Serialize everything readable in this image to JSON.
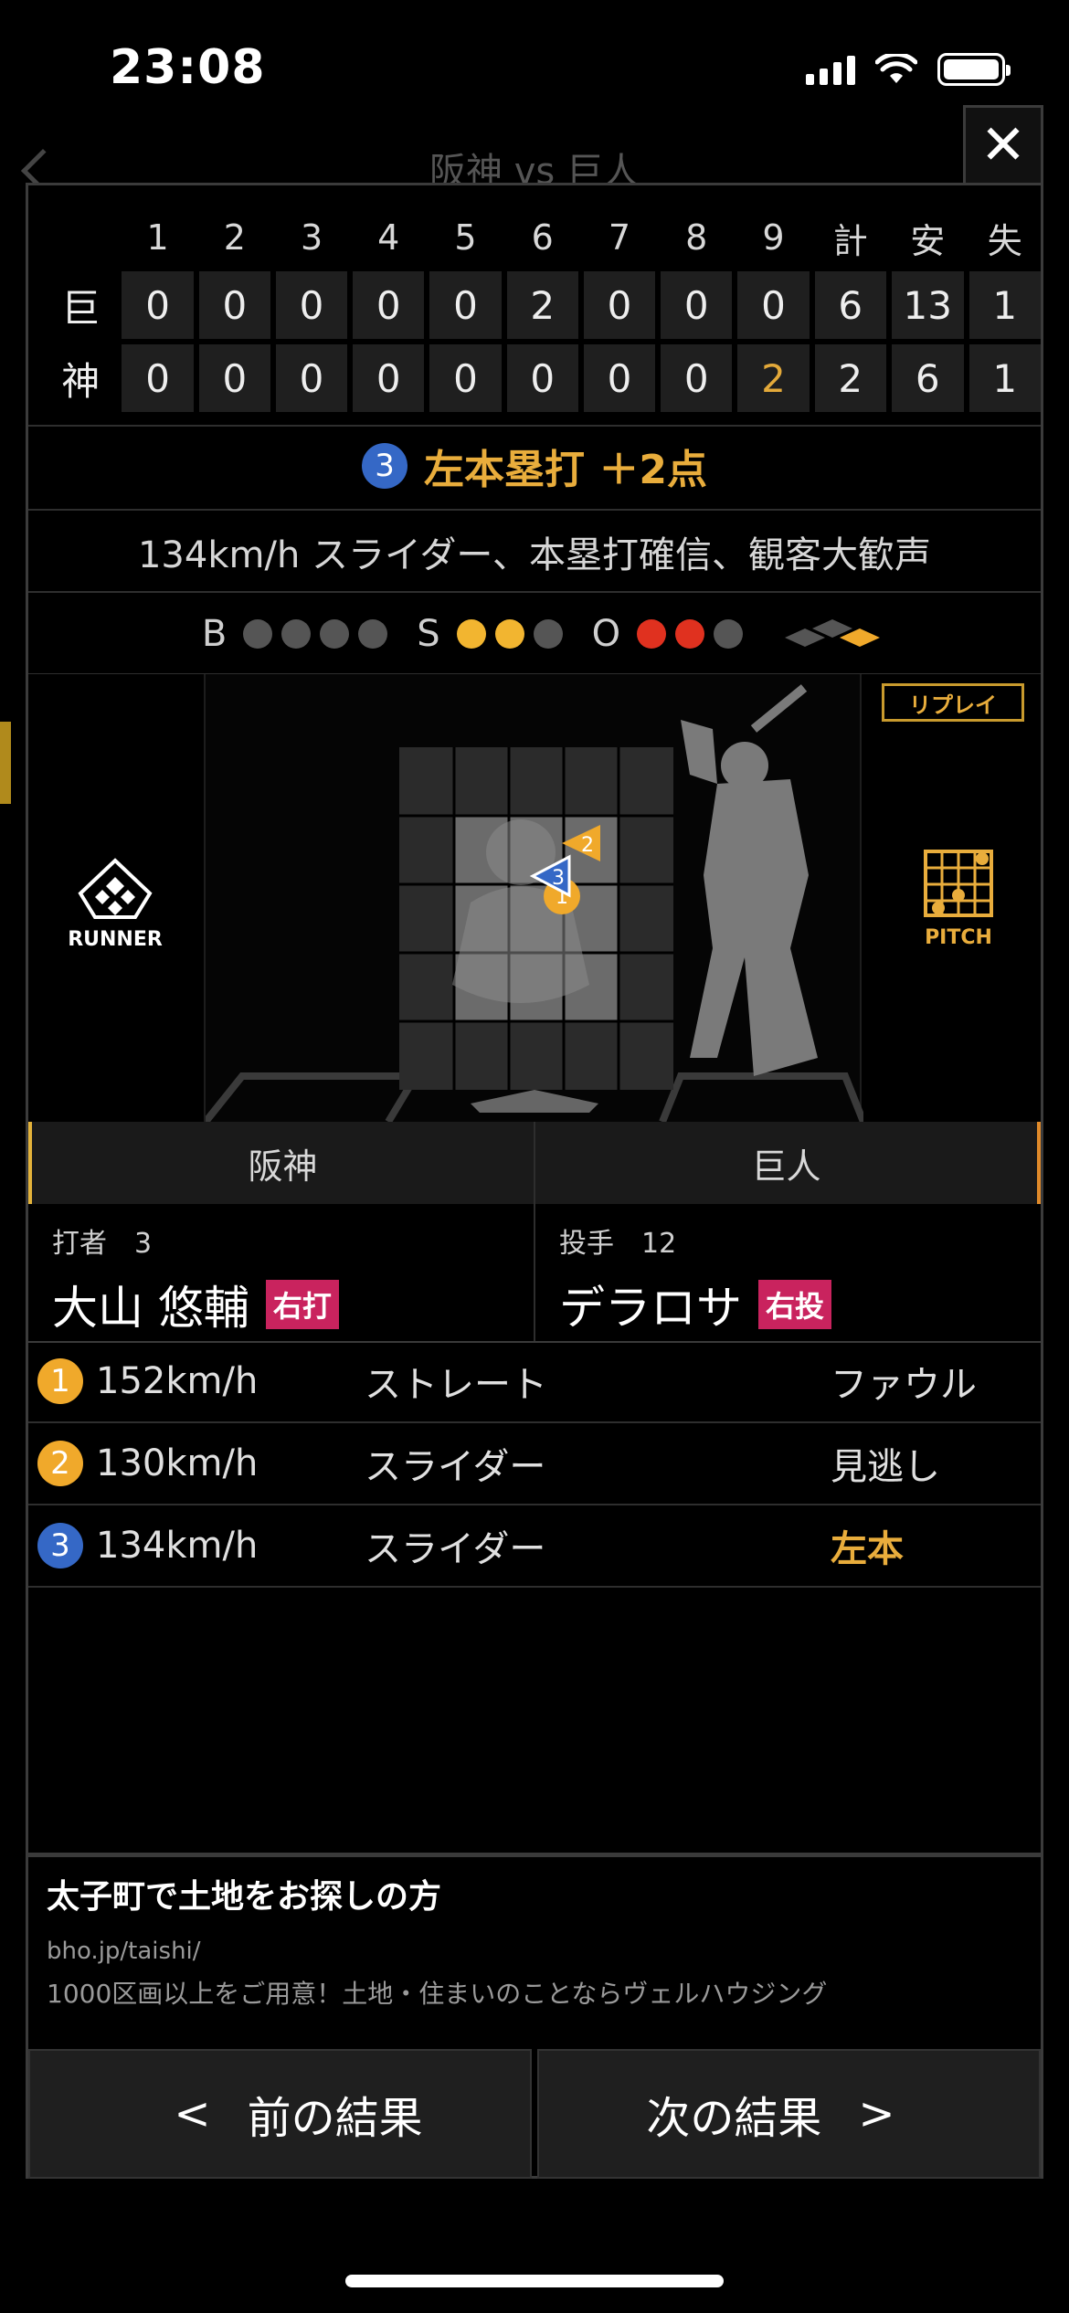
{
  "status_bar": {
    "time": "23:08"
  },
  "background": {
    "title": "阪神 vs 巨人"
  },
  "close_label": "✕",
  "scoreboard": {
    "headers": [
      "1",
      "2",
      "3",
      "4",
      "5",
      "6",
      "7",
      "8",
      "9",
      "計",
      "安",
      "失"
    ],
    "rows": [
      {
        "team": "巨",
        "cells": [
          "0",
          "0",
          "0",
          "0",
          "0",
          "2",
          "0",
          "0",
          "0",
          "6",
          "13",
          "1"
        ]
      },
      {
        "team": "神",
        "cells": [
          "0",
          "0",
          "0",
          "0",
          "0",
          "0",
          "0",
          "0",
          "2",
          "2",
          "6",
          "1"
        ]
      }
    ]
  },
  "play": {
    "badge": "3",
    "result": "左本塁打 ＋2点",
    "description": "134km/h スライダー、本塁打確信、観客大歓声"
  },
  "count": {
    "b_label": "B",
    "s_label": "S",
    "o_label": "O",
    "balls": 0,
    "strikes": 2,
    "outs": 2
  },
  "field": {
    "runner_label": "RUNNER",
    "pitch_label": "PITCH",
    "replay_label": "リプレイ",
    "markers": [
      "1",
      "2",
      "3"
    ]
  },
  "teams": {
    "left": "阪神",
    "right": "巨人"
  },
  "batter": {
    "role": "打者　3",
    "name": "大山 悠輔",
    "tag": "右打"
  },
  "pitcher": {
    "role": "投手　12",
    "name": "デラロサ",
    "tag": "右投"
  },
  "pitches": [
    {
      "num": "1",
      "speed": "152km/h",
      "type": "ストレート",
      "result": "ファウル",
      "color": "#f0a92b"
    },
    {
      "num": "2",
      "speed": "130km/h",
      "type": "スライダー",
      "result": "見逃し",
      "color": "#f0a92b"
    },
    {
      "num": "3",
      "speed": "134km/h",
      "type": "スライダー",
      "result": "左本",
      "color": "#3568c6"
    }
  ],
  "ad": {
    "title": "太子町で土地をお探しの方",
    "url": "bho.jp/taishi/",
    "description": "1000区画以上をご用意！土地・住まいのことならヴェルハウジング"
  },
  "nav": {
    "prev_arrow": "<",
    "prev": "前の結果",
    "next": "次の結果",
    "next_arrow": ">"
  }
}
